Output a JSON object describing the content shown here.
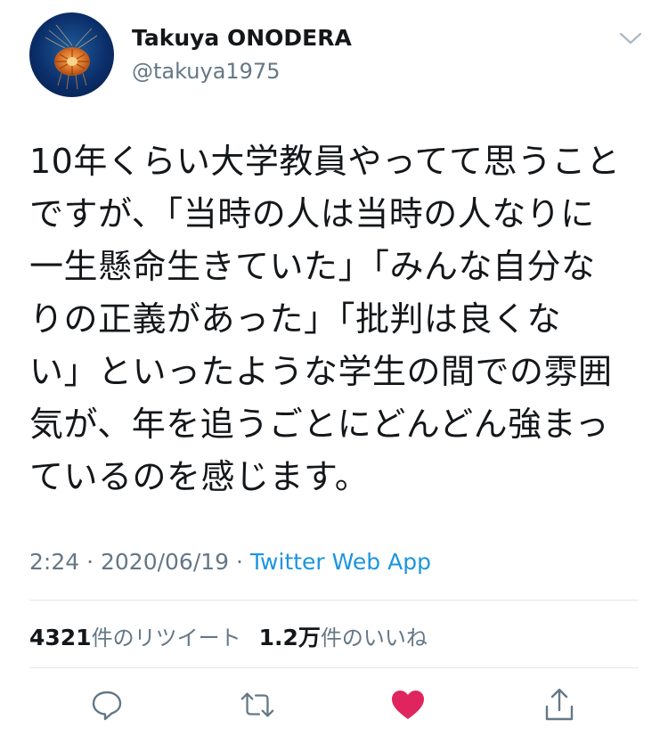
{
  "user": {
    "display_name": "Takuya ONODERA",
    "handle": "@takuya1975"
  },
  "tweet": {
    "text": "10年くらい大学教員やってて思うこと\nですが、「当時の人は当時の人なりに\n一生懸命生きていた」「みんな自分な\nりの正義があった」「批判は良くな\nい」といったような学生の間での雰囲\n気が、年を追うごとにどんどん強まっ\nているのを感じます。"
  },
  "meta": {
    "time": "2:24",
    "separator1": " · ",
    "date": "2020/06/19",
    "separator2": " · ",
    "source": "Twitter Web App"
  },
  "stats": {
    "retweet_count": "4321",
    "retweet_label": "件のリツイート",
    "like_count": "1.2万",
    "like_label": "件のいいね"
  },
  "actions": [
    {
      "name": "reply",
      "icon": "reply-icon"
    },
    {
      "name": "retweet",
      "icon": "retweet-icon"
    },
    {
      "name": "like",
      "icon": "heart-icon",
      "state": "liked"
    },
    {
      "name": "share",
      "icon": "share-icon"
    }
  ],
  "colors": {
    "primary_text": "#14171a",
    "secondary_text": "#657786",
    "link": "#1b95e0",
    "like": "#e0245e",
    "divider": "#e1e8ed"
  }
}
